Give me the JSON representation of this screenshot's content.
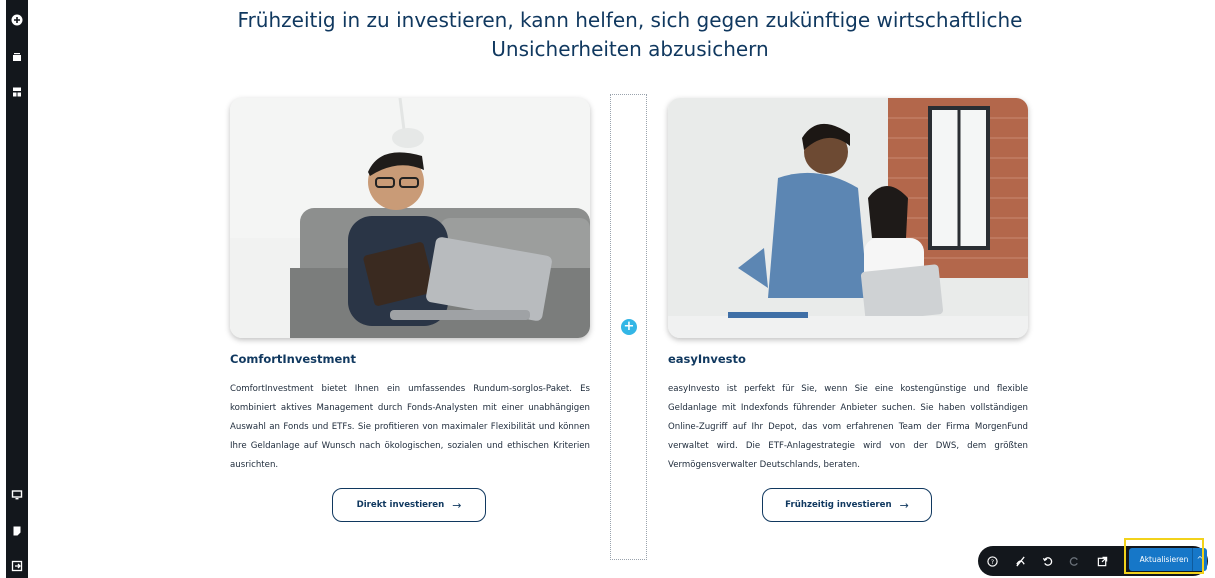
{
  "heading": "Frühzeitig in zu investieren, kann helfen, sich gegen zukünftige wirtschaftliche Unsicherheiten abzusichern",
  "sidebar": {
    "top_icons": [
      "plus-circle-icon",
      "layers-icon",
      "columns-icon"
    ],
    "bottom_icons": [
      "monitor-icon",
      "page-icon",
      "exit-icon"
    ]
  },
  "cards": [
    {
      "title": "ComfortInvestment",
      "text": "ComfortInvestment bietet Ihnen ein umfassendes Rundum-sorglos-Paket. Es kombiniert aktives Management durch Fonds-Analysten mit einer unabhängigen Auswahl an Fonds und ETFs. Sie profitieren von maximaler Flexibilität und können Ihre Geldanlage auf Wunsch nach ökologischen, sozialen und ethischen Kriterien ausrichten.",
      "button": "Direkt investieren",
      "button_arrow": "→",
      "image": "man-with-laptop-on-sofa"
    },
    {
      "title": "easyInvesto",
      "text": "easyInvesto ist perfekt für Sie, wenn Sie eine kostengünstige und flexible Geldanlage mit Indexfonds führender Anbieter suchen. Sie haben vollständigen Online-Zugriff auf Ihr Depot, das vom erfahrenen Team der Firma MorgenFund verwaltet wird. Die ETF-Anlagestrategie wird von der DWS, dem größten Vermögensverwalter Deutschlands, beraten.",
      "button": "Frühzeitig investieren",
      "button_arrow": "→",
      "image": "two-people-at-laptop"
    }
  ],
  "dropzone": {
    "add_symbol": "+"
  },
  "toolbar": {
    "icons": [
      "help-icon",
      "no-preview-icon",
      "undo-icon",
      "redo-icon",
      "external-link-icon"
    ],
    "update_label": "Aktualisieren",
    "update_caret": "^"
  },
  "colors": {
    "heading": "#10385f",
    "sidebar": "#13171c",
    "accent": "#33b6e6",
    "update_button": "#1677c8",
    "highlight": "#f2d21b"
  }
}
